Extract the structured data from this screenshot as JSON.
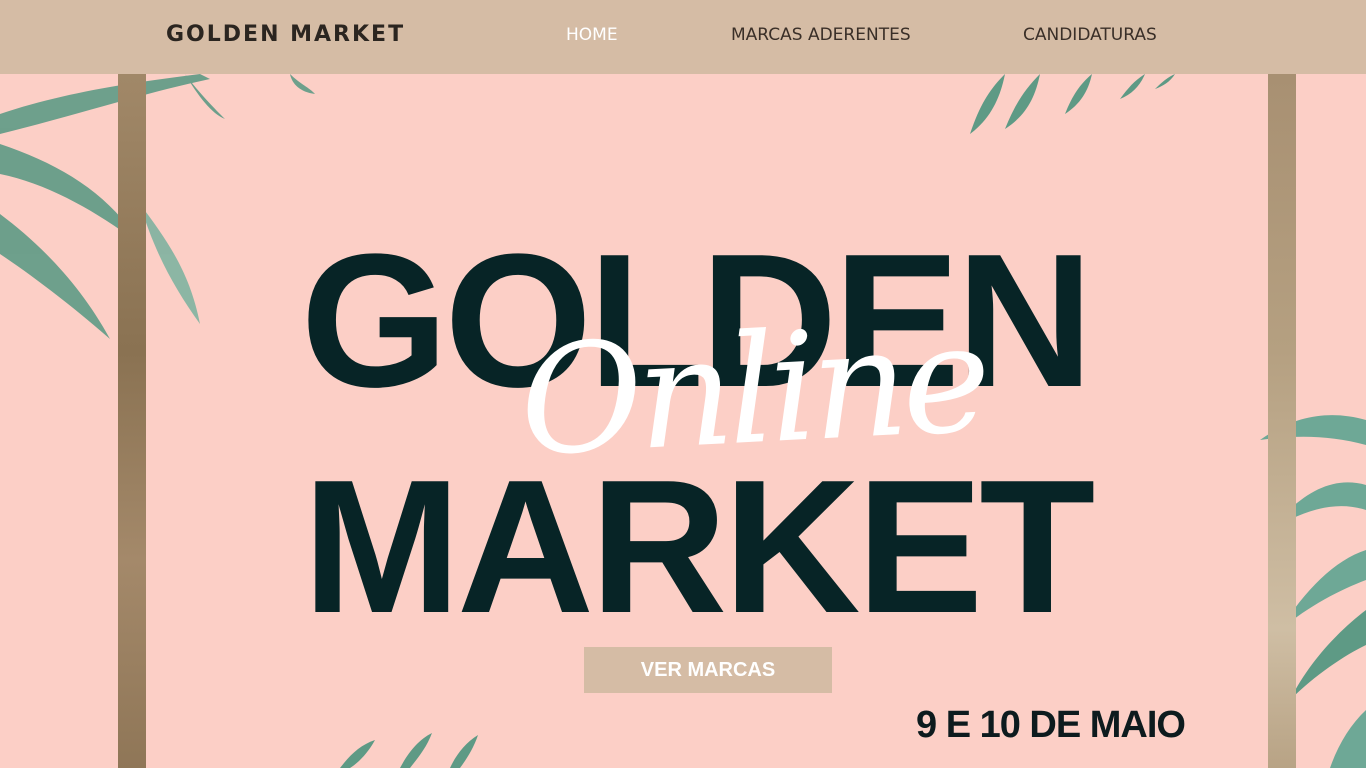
{
  "header": {
    "brand": "GOLDEN MARKET",
    "nav": [
      {
        "label": "HOME"
      },
      {
        "label": "MARCAS ADERENTES"
      },
      {
        "label": "CANDIDATURAS"
      }
    ]
  },
  "hero": {
    "title_line1": "GOLDEN",
    "title_line2": "MARKET",
    "script_word": "Online",
    "cta_label": "VER MARCAS",
    "date": "9 E 10 DE MAIO"
  },
  "colors": {
    "background": "#fccfc6",
    "header_bg": "#d5bca5",
    "title": "#072426",
    "pillar_gold": "#a18868",
    "leaf_green": "#5f9b86"
  },
  "decor": {
    "leaves": "tropical-leaf-icon"
  }
}
